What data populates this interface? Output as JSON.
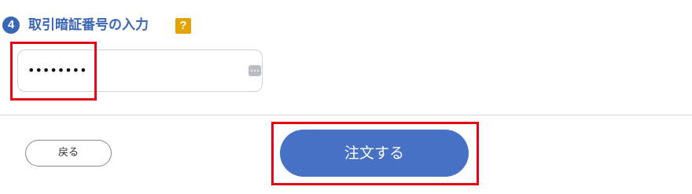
{
  "section": {
    "step_number": "4",
    "title": "取引暗証番号の入力",
    "help_icon_label": "?"
  },
  "password_field": {
    "masked_value": "••••••••",
    "icon": "password-manager-key-icon"
  },
  "buttons": {
    "back_label": "戻る",
    "order_label": "注文する"
  },
  "colors": {
    "accent_blue": "#3a66b7",
    "order_button": "#4671c4",
    "help_badge": "#e4a300",
    "highlight_red": "#e60012"
  }
}
